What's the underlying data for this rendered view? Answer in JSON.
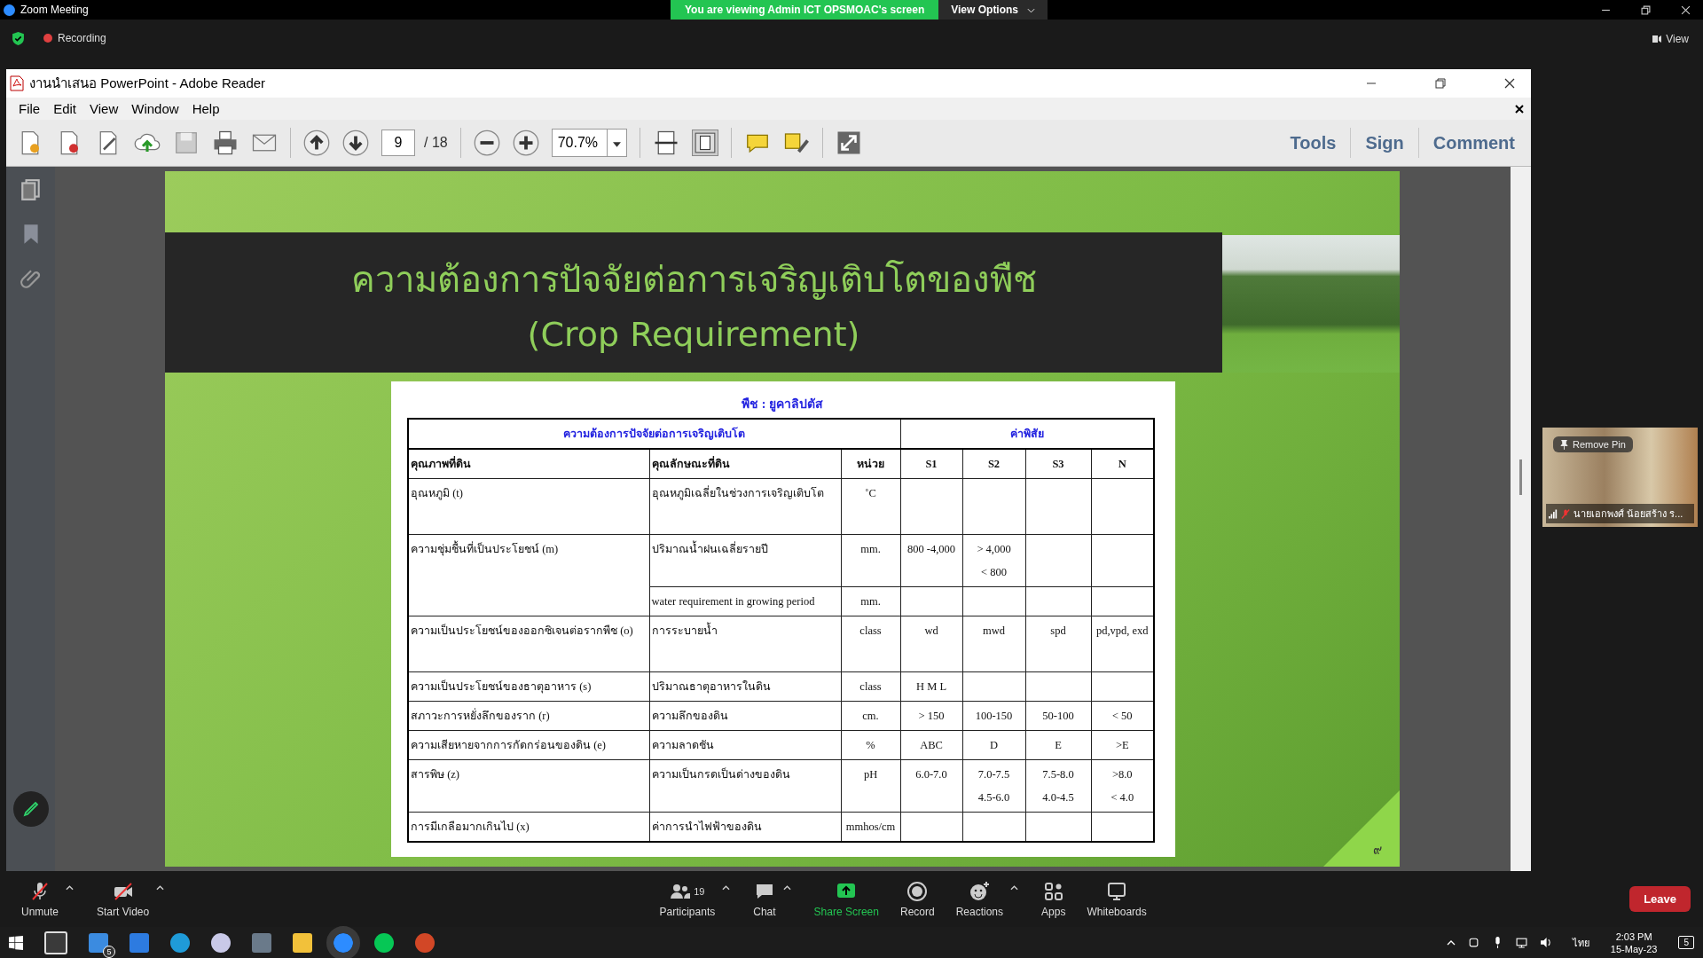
{
  "zoom_window": {
    "title": "Zoom Meeting",
    "banner": "You are viewing Admin ICT OPSMOAC's screen",
    "view_options": "View Options",
    "recording": "Recording",
    "view_button": "View"
  },
  "reader_window": {
    "title": "งานนำเสนอ PowerPoint - Adobe Reader",
    "menu": [
      "File",
      "Edit",
      "View",
      "Window",
      "Help"
    ],
    "page": "9",
    "page_total": "/ 18",
    "zoom": "70.7%",
    "panels": [
      "Tools",
      "Sign",
      "Comment"
    ]
  },
  "slide": {
    "title": "ความต้องการปัจจัยต่อการเจริญเติบโตของพืช",
    "subtitle": "(Crop Requirement)",
    "page_number": "๙",
    "table": {
      "caption": "พืช : ยูคาลิปตัส",
      "group_headers": [
        "ความต้องการปัจจัยต่อการเจริญเติบโต",
        "ค่าพิสัย"
      ],
      "columns": [
        "คุณภาพที่ดิน",
        "คุณลักษณะที่ดิน",
        "หน่วย",
        "S1",
        "S2",
        "S3",
        "N"
      ],
      "rows": [
        {
          "quality": "อุณหภูมิ (t)",
          "items": [
            {
              "characteristic": "อุณหภูมิเฉลี่ยในช่วงการเจริญเติบโต",
              "unit": "˚C"
            }
          ]
        },
        {
          "quality": "ความชุ่มชื้นที่เป็นประโยชน์ (m)",
          "items": [
            {
              "characteristic": "ปริมาณน้ำฝนเฉลี่ยรายปี",
              "unit": "mm.",
              "s1": [
                "800 -4,000"
              ],
              "s2": [
                "> 4,000",
                "< 800"
              ]
            },
            {
              "characteristic": "water requirement in growing period",
              "unit": "mm."
            }
          ]
        },
        {
          "quality": "ความเป็นประโยชน์ของออกซิเจนต่อรากพืช (o)",
          "items": [
            {
              "characteristic": "การระบายน้ำ",
              "unit": "class",
              "s1": [
                "wd"
              ],
              "s2": [
                "mwd"
              ],
              "s3": [
                "spd"
              ],
              "n": [
                "pd,vpd, exd"
              ]
            }
          ]
        },
        {
          "quality": "ความเป็นประโยชน์ของธาตุอาหาร (s)",
          "items": [
            {
              "characteristic": "ปริมาณธาตุอาหารในดิน",
              "unit": "class",
              "s1": [
                "H M L"
              ]
            }
          ]
        },
        {
          "quality": "สภาวะการหยั่งลึกของราก (r)",
          "items": [
            {
              "characteristic": "ความลึกของดิน",
              "unit": "cm.",
              "s1": [
                "> 150"
              ],
              "s2": [
                "100-150"
              ],
              "s3": [
                "50-100"
              ],
              "n": [
                "< 50"
              ]
            }
          ]
        },
        {
          "quality": "ความเสียหายจากการกัดกร่อนของดิน (e)",
          "items": [
            {
              "characteristic": "ความลาดชัน",
              "unit": "%",
              "s1": [
                "ABC"
              ],
              "s2": [
                "D"
              ],
              "s3": [
                "E"
              ],
              "n": [
                ">E"
              ]
            }
          ]
        },
        {
          "quality": "สารพิษ (z)",
          "items": [
            {
              "characteristic": "ความเป็นกรดเป็นด่างของดิน",
              "unit": "pH",
              "s1": [
                "6.0-7.0"
              ],
              "s2": [
                "7.0-7.5",
                "4.5-6.0"
              ],
              "s3": [
                "7.5-8.0",
                "4.0-4.5"
              ],
              "n": [
                ">8.0",
                "< 4.0"
              ]
            }
          ]
        },
        {
          "quality": "การมีเกลือมากเกินไป (x)",
          "items": [
            {
              "characteristic": "ค่าการนำไฟฟ้าของดิน",
              "unit": "mmhos/cm"
            }
          ]
        }
      ]
    }
  },
  "participant": {
    "pin_label": "Remove Pin",
    "name": "นายเอกพงศ์ น้อยสร้าง ร..."
  },
  "meeting_controls": [
    {
      "kind": "mic",
      "label": "Unmute"
    },
    {
      "kind": "video",
      "label": "Start Video"
    },
    {
      "kind": "people",
      "label": "Participants",
      "count": "19"
    },
    {
      "kind": "chat",
      "label": "Chat"
    },
    {
      "kind": "share",
      "label": "Share Screen"
    },
    {
      "kind": "record",
      "label": "Record"
    },
    {
      "kind": "reactions",
      "label": "Reactions"
    },
    {
      "kind": "apps",
      "label": "Apps"
    },
    {
      "kind": "whiteboard",
      "label": "Whiteboards"
    }
  ],
  "leave_button": "Leave",
  "taskbar": {
    "mail_badge": "5",
    "time": "2:03 PM",
    "date": "15-May-23",
    "language": "ไทย",
    "notification_badge": "5"
  }
}
